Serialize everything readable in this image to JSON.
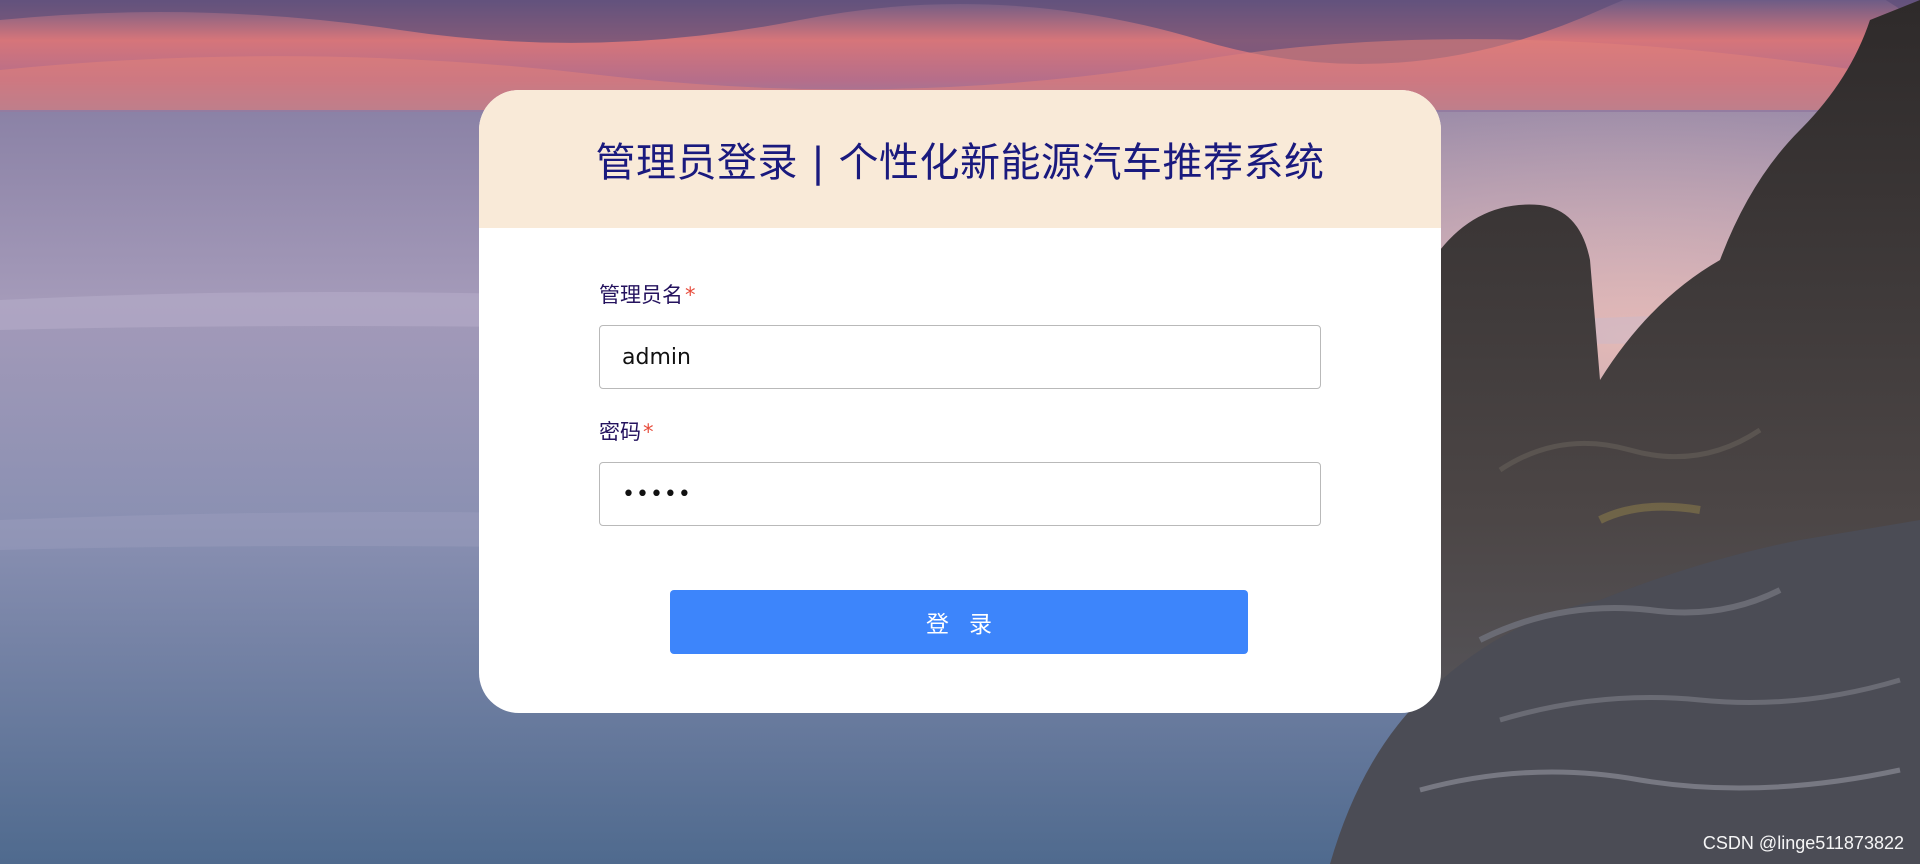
{
  "header": {
    "title": "管理员登录 | 个性化新能源汽车推荐系统"
  },
  "form": {
    "username": {
      "label": "管理员名",
      "required_mark": "*",
      "value": "admin"
    },
    "password": {
      "label": "密码",
      "required_mark": "*",
      "value": "•••••"
    },
    "submit_label": "登录"
  },
  "watermark": "CSDN @linge511873822",
  "colors": {
    "header_bg": "#f9ead8",
    "title": "#1a1a7e",
    "button": "#3d85fb",
    "required": "#e74c3c"
  }
}
